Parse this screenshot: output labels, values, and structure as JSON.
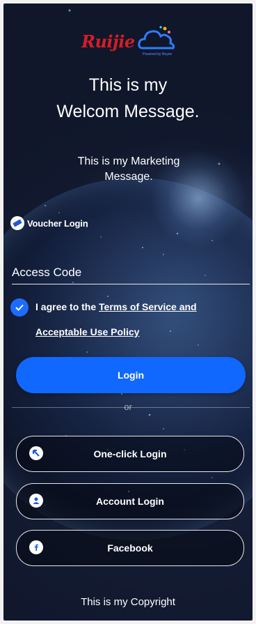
{
  "brand": {
    "logo_text": "Ruijie",
    "tagline": "Powered by Reyee"
  },
  "welcome": {
    "line1": "This is my",
    "line2": "Welcom Message."
  },
  "marketing": {
    "line1": "This is my Marketing",
    "line2": "Message."
  },
  "voucher": {
    "label": "Voucher Login",
    "icon": "voucher-icon"
  },
  "access_code": {
    "placeholder": "Access Code",
    "value": ""
  },
  "agreement": {
    "checked": true,
    "prefix": "I agree to the",
    "link_part1": "Terms of Service and",
    "link_part2": "Acceptable Use Policy"
  },
  "login_button": {
    "label": "Login"
  },
  "divider": {
    "label": "or"
  },
  "alternatives": [
    {
      "label": "One-click Login",
      "icon": "one-click-icon"
    },
    {
      "label": "Account Login",
      "icon": "user-icon"
    },
    {
      "label": "Facebook",
      "icon": "facebook-icon"
    }
  ],
  "footer": {
    "copyright": "This is my Copyright"
  },
  "colors": {
    "accent": "#1068ff",
    "checkbox": "#1e6cff",
    "brand_red": "#d51e26",
    "background": "#141c33"
  }
}
